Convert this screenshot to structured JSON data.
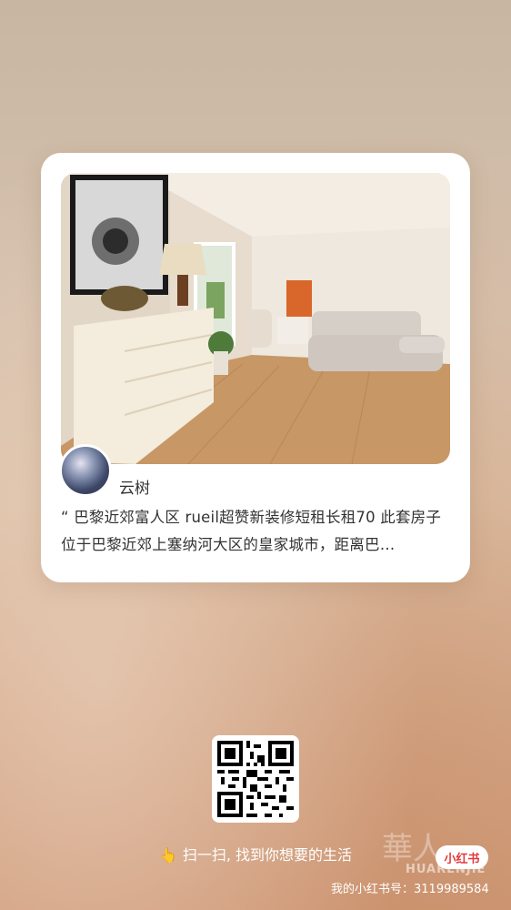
{
  "card": {
    "author": "云树",
    "description": "“ 巴黎近郊富人区 rueil超赞新装修短租长租70 此套房子位于巴黎近郊上塞纳河大区的皇家城市，距离巴…"
  },
  "footer": {
    "hint_emoji": "👆",
    "hint_text": "扫一扫, 找到你想要的生活",
    "brand": "小红书",
    "account": "我的小红书号：3119989584",
    "watermark_cn": "華人",
    "watermark_en": "HUARENJIE"
  }
}
